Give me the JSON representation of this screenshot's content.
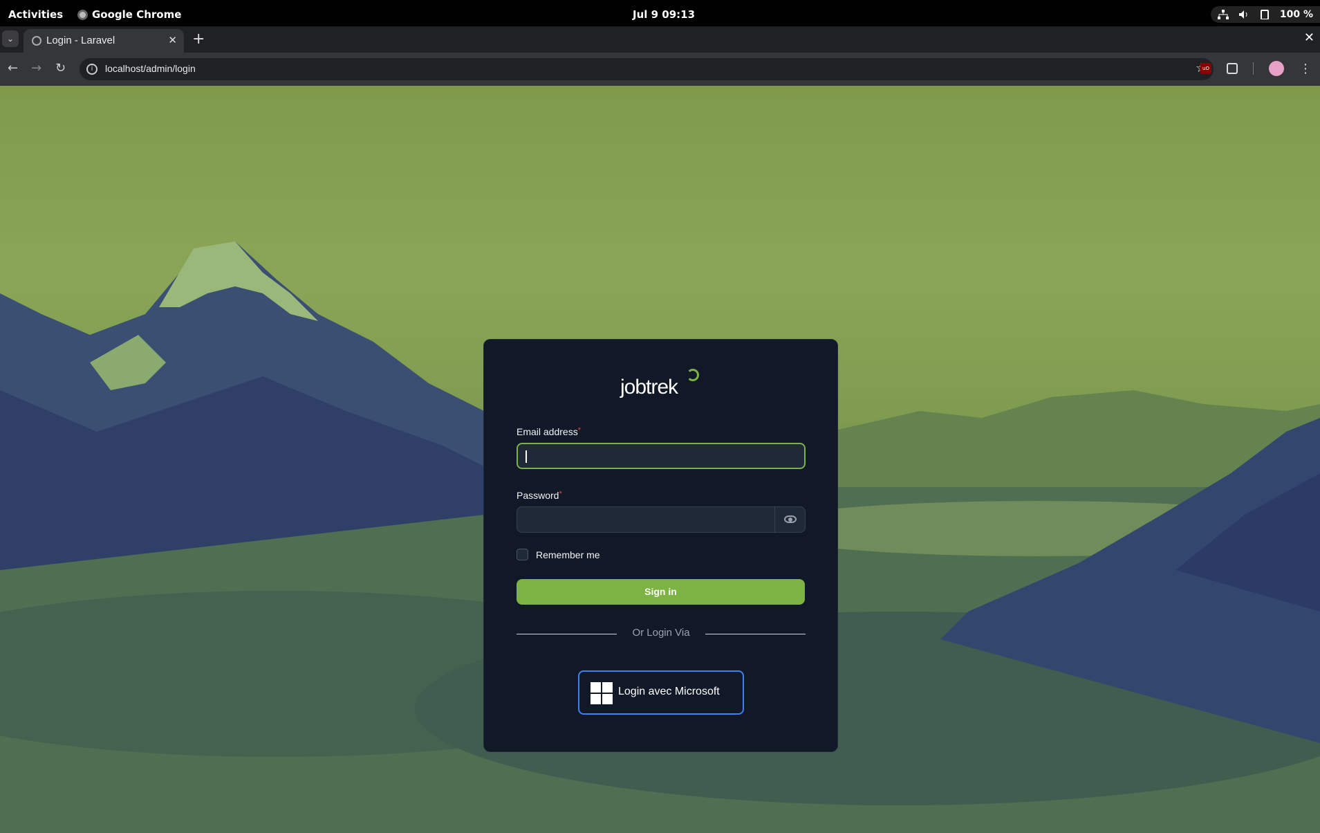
{
  "system_bar": {
    "activities": "Activities",
    "app_name": "Google Chrome",
    "clock": "Jul 9  09:13",
    "battery": "100 %"
  },
  "browser": {
    "tab_title": "Login - Laravel",
    "url": "localhost/admin/login",
    "extension_badge": "uO"
  },
  "login": {
    "logo_text": "jobtrek",
    "email_label": "Email address",
    "required_mark": "*",
    "email_value": "",
    "password_label": "Password",
    "password_value": "",
    "remember_label": "Remember me",
    "signin_label": "Sign in",
    "divider_text": "Or Login Via",
    "microsoft_label": "Login avec Microsoft"
  },
  "colors": {
    "accent": "#7cb342",
    "card_bg": "#111827",
    "input_bg": "#1f2937",
    "microsoft_border": "#3b82f6"
  }
}
